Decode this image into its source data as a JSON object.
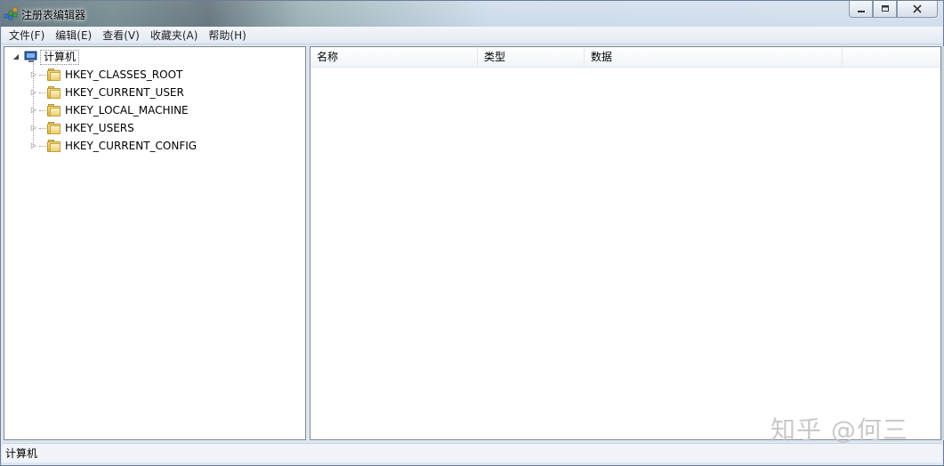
{
  "window": {
    "title": "注册表编辑器",
    "caption_buttons": [
      "minimize",
      "maximize",
      "close"
    ]
  },
  "menu": {
    "items": [
      "文件(F)",
      "编辑(E)",
      "查看(V)",
      "收藏夹(A)",
      "帮助(H)"
    ]
  },
  "tree": {
    "root_label": "计算机",
    "root_icon": "computer-icon",
    "items": [
      {
        "label": "HKEY_CLASSES_ROOT",
        "icon": "folder-icon"
      },
      {
        "label": "HKEY_CURRENT_USER",
        "icon": "folder-icon"
      },
      {
        "label": "HKEY_LOCAL_MACHINE",
        "icon": "folder-icon"
      },
      {
        "label": "HKEY_USERS",
        "icon": "folder-icon"
      },
      {
        "label": "HKEY_CURRENT_CONFIG",
        "icon": "folder-icon"
      }
    ]
  },
  "list": {
    "columns": [
      "名称",
      "类型",
      "数据"
    ]
  },
  "status": {
    "text": "计算机"
  },
  "watermark": "知乎 @何三"
}
